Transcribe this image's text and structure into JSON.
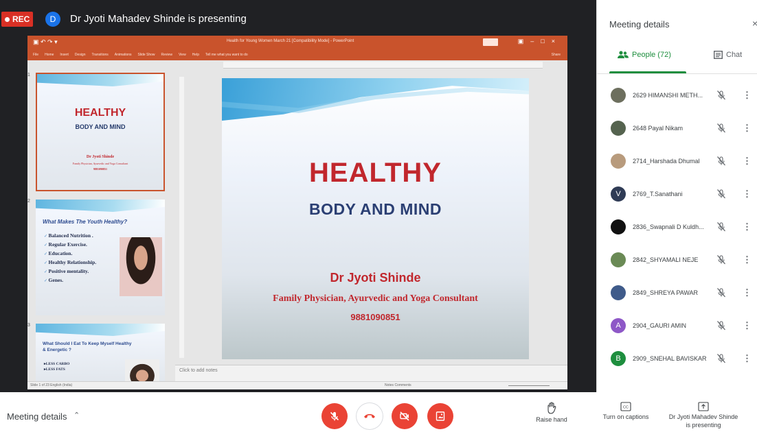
{
  "recording": {
    "label": "REC"
  },
  "presenter": {
    "avatar_letter": "D",
    "banner": "Dr Jyoti Mahadev Shinde is presenting"
  },
  "ppt": {
    "doc_title": "Health for Young Women March 21 [Compatibility Mode] - PowerPoint",
    "ribbon_tabs": [
      "File",
      "Home",
      "Insert",
      "Design",
      "Transitions",
      "Animations",
      "Slide Show",
      "Review",
      "View",
      "Help",
      "Tell me what you want to do"
    ],
    "share": "Share",
    "notes_placeholder": "Click to add notes",
    "status_left": "Slide 1 of 23   English (India)",
    "status_right": "Notes   Comments"
  },
  "thumbnails": {
    "slide1": {
      "num": "1",
      "title": "HEALTHY",
      "subtitle": "BODY AND MIND",
      "name": "Dr Jyoti Shinde",
      "role": "Family Physician, Ayurvedic and Yoga Consultant",
      "phone": "9881090851"
    },
    "slide2": {
      "num": "2",
      "heading": "What Makes The Youth Healthy?",
      "items": [
        "Balanced Nutrition .",
        "Regular Exercise.",
        "Education.",
        "Healthy Relationship.",
        "Positive mentality.",
        "Genes."
      ]
    },
    "slide3": {
      "num": "3",
      "heading": "What Should I Eat To Keep Myself Healthy & Energetic ?",
      "items": [
        "LESS CARBO",
        "LESS FATS"
      ]
    }
  },
  "slide": {
    "title": "HEALTHY",
    "subtitle": "BODY AND MIND",
    "name": "Dr Jyoti  Shinde",
    "role": "Family Physician, Ayurvedic and Yoga Consultant",
    "phone": "9881090851"
  },
  "panel": {
    "title": "Meeting details",
    "close": "×",
    "people_tab": "People (72)",
    "chat_tab": "Chat",
    "people": [
      {
        "name": "2629 HIMANSHI METH...",
        "avatar_color": "#6d6f5e",
        "letter": ""
      },
      {
        "name": "2648 Payal Nikam",
        "avatar_color": "#55634f",
        "letter": ""
      },
      {
        "name": "2714_Harshada Dhumal",
        "avatar_color": "#b89b7d",
        "letter": ""
      },
      {
        "name": "2769_T.Sanathani",
        "avatar_color": "#2f3b55",
        "letter": "V"
      },
      {
        "name": "2836_Swapnali D Kuldh...",
        "avatar_color": "#111111",
        "letter": ""
      },
      {
        "name": "2842_SHYAMALI NEJE",
        "avatar_color": "#6a8a55",
        "letter": ""
      },
      {
        "name": "2849_SHREYA PAWAR",
        "avatar_color": "#3f5b8a",
        "letter": ""
      },
      {
        "name": "2904_GAURI AMIN",
        "avatar_color": "#8e58c7",
        "letter": "A"
      },
      {
        "name": "2909_SNEHAL BAVISKAR",
        "avatar_color": "#1e8e3e",
        "letter": "B"
      }
    ]
  },
  "bottom": {
    "meeting_details": "Meeting details",
    "raise_hand": "Raise hand",
    "captions": "Turn on captions",
    "presenting_line1": "Dr Jyoti Mahadev Shinde",
    "presenting_line2": "is presenting"
  },
  "colors": {
    "accent_green": "#1e8e3e",
    "danger_red": "#ea4335",
    "ppt_orange": "#c9532c",
    "slide_red": "#c1272d",
    "slide_navy": "#2b3f73"
  }
}
